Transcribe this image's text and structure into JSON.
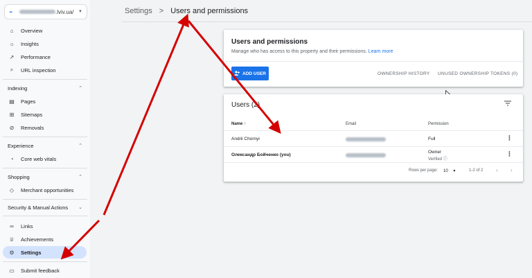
{
  "sidebar": {
    "property": {
      "blurred_prefix": "",
      "suffix": ".lviv.ua/"
    },
    "nav_top": [
      {
        "label": "Overview",
        "icon": "home-icon",
        "glyph": "⌂"
      },
      {
        "label": "Insights",
        "icon": "lightbulb-icon",
        "glyph": "☼"
      },
      {
        "label": "Performance",
        "icon": "trending-icon",
        "glyph": "↗"
      },
      {
        "label": "URL inspection",
        "icon": "search-icon",
        "glyph": "⌕"
      }
    ],
    "section_indexing": "Indexing",
    "nav_indexing": [
      {
        "label": "Pages",
        "icon": "pages-icon",
        "glyph": "▤"
      },
      {
        "label": "Sitemaps",
        "icon": "sitemap-icon",
        "glyph": "⊞"
      },
      {
        "label": "Removals",
        "icon": "removals-icon",
        "glyph": "⊘"
      }
    ],
    "section_experience": "Experience",
    "nav_experience": [
      {
        "label": "Core web vitals",
        "icon": "gauge-icon",
        "glyph": "◔"
      }
    ],
    "section_shopping": "Shopping",
    "nav_shopping": [
      {
        "label": "Merchant opportunities",
        "icon": "tag-icon",
        "glyph": "◇"
      }
    ],
    "section_security": "Security & Manual Actions",
    "nav_bottom": [
      {
        "label": "Links",
        "icon": "link-icon",
        "glyph": "∞"
      },
      {
        "label": "Achievements",
        "icon": "trophy-icon",
        "glyph": "♕"
      },
      {
        "label": "Settings",
        "icon": "gear-icon",
        "glyph": "⚙"
      }
    ],
    "feedback": {
      "label": "Submit feedback",
      "icon": "feedback-icon",
      "glyph": "▭"
    }
  },
  "breadcrumb": {
    "root": "Settings",
    "separator": ">",
    "current": "Users and permissions"
  },
  "permissions_card": {
    "title": "Users and permissions",
    "description": "Manage who has access to this property and their permissions.",
    "learn_more": "Learn more",
    "add_user": "ADD USER",
    "ownership_history": "OWNERSHIP HISTORY",
    "unused_tokens": "UNUSED OWNERSHIP TOKENS (0)"
  },
  "users_card": {
    "title": "Users (2)",
    "columns": {
      "name": "Name",
      "sort_indicator": "↑",
      "email": "Email",
      "permission": "Permission"
    },
    "rows": [
      {
        "name": "Andrii Chornyi",
        "permission": "Full",
        "permission_sub": ""
      },
      {
        "name": "Олександр Бойченко (you)",
        "permission": "Owner",
        "permission_sub": "Verified"
      }
    ],
    "pagination": {
      "rows_label": "Rows per page:",
      "rows_value": "10",
      "range": "1-2 of 2"
    }
  },
  "colors": {
    "accent": "#1a73e8",
    "annotation": "#d40000",
    "active_nav": "#d3e3fd"
  }
}
